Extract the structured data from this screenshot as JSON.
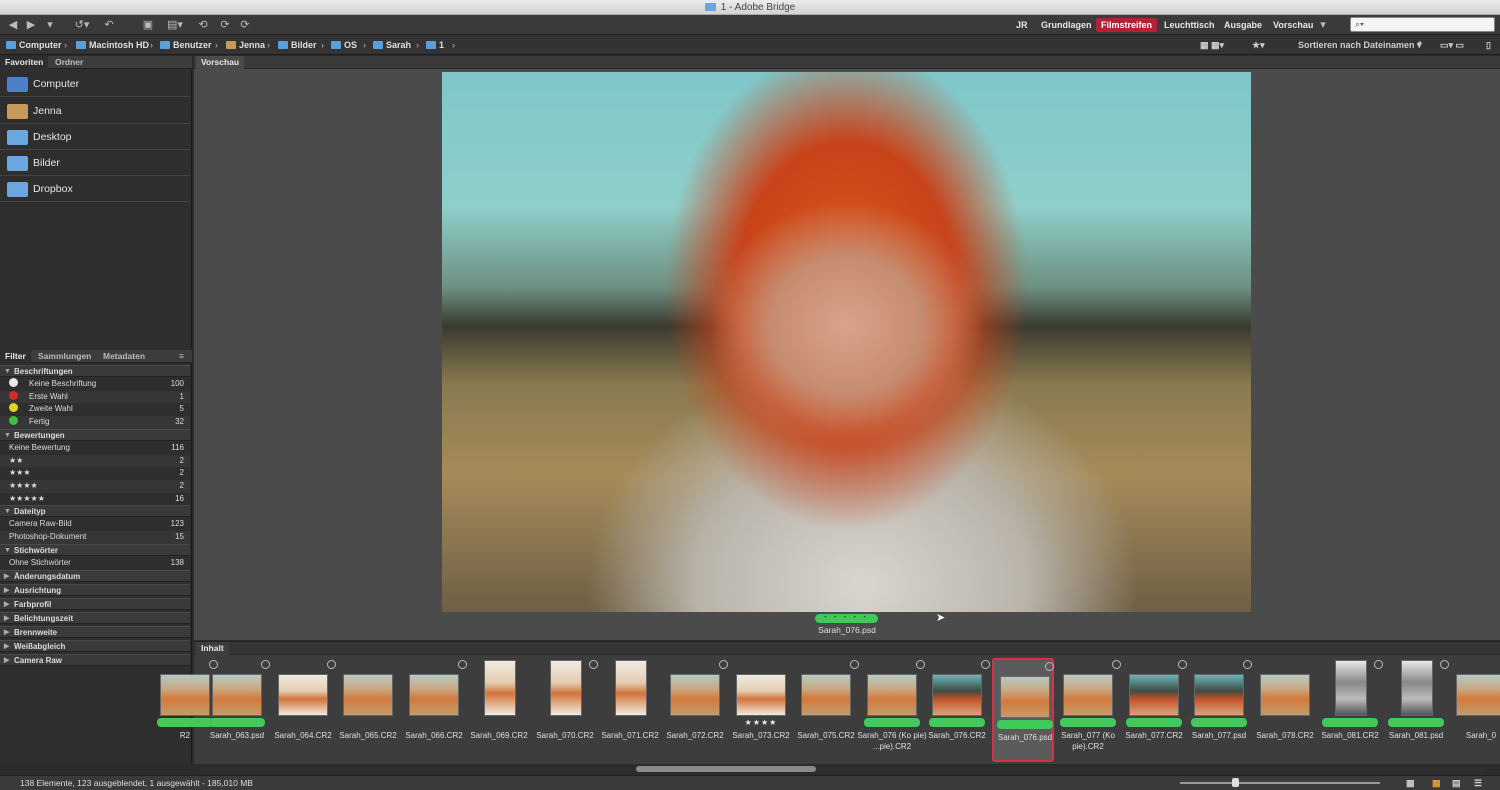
{
  "window": {
    "title": "1 - Adobe Bridge"
  },
  "toolbar": {
    "workspaces": [
      "JR",
      "Grundlagen",
      "Filmstreifen",
      "Leuchttisch",
      "Ausgabe",
      "Vorschau"
    ],
    "active_workspace": "Filmstreifen",
    "search_placeholder": "⌕▾",
    "icons": [
      "back-icon",
      "forward-icon",
      "recent-icon",
      "boomerang-icon",
      "camera-download-icon",
      "output-icon",
      "refine-icon",
      "rotate-left-icon",
      "rotate-right-icon",
      "workspace-menu-icon"
    ]
  },
  "path": {
    "crumbs": [
      "Computer",
      "Macintosh HD",
      "Benutzer",
      "Jenna",
      "Bilder",
      "OS",
      "Sarah",
      "1"
    ],
    "sort_label": "Sortieren nach Dateinamen",
    "icons": [
      "quality-icon",
      "star-filter-icon",
      "sort-asc-icon",
      "new-folder-icon",
      "delete-icon"
    ]
  },
  "left_panel": {
    "top_tabs": [
      "Favoriten",
      "Ordner"
    ],
    "favorites": [
      "Computer",
      "Jenna",
      "Desktop",
      "Bilder",
      "Dropbox"
    ],
    "bottom_tabs": [
      "Filter",
      "Sammlungen",
      "Metadaten"
    ],
    "filter_groups": [
      {
        "title": "Beschriftungen",
        "rows": [
          {
            "label": "Keine Beschriftung",
            "count": "100",
            "color": "#e8e8e8"
          },
          {
            "label": "Erste Wahl",
            "count": "1",
            "color": "#d42a2a"
          },
          {
            "label": "Zweite Wahl",
            "count": "5",
            "color": "#e6d21e"
          },
          {
            "label": "Fertig",
            "count": "32",
            "color": "#3fbf3f"
          }
        ]
      },
      {
        "title": "Bewertungen",
        "rows": [
          {
            "label": "Keine Bewertung",
            "count": "116"
          },
          {
            "label": "★★",
            "count": "2"
          },
          {
            "label": "★★★",
            "count": "2"
          },
          {
            "label": "★★★★",
            "count": "2"
          },
          {
            "label": "★★★★★",
            "count": "16"
          }
        ]
      },
      {
        "title": "Dateityp",
        "rows": [
          {
            "label": "Camera Raw-Bild",
            "count": "123"
          },
          {
            "label": "Photoshop-Dokument",
            "count": "15"
          }
        ]
      },
      {
        "title": "Stichwörter",
        "rows": [
          {
            "label": "Ohne Stichwörter",
            "count": "138"
          }
        ]
      }
    ],
    "collapsed_groups": [
      "Änderungsdatum",
      "Ausrichtung",
      "Farbprofil",
      "Belichtungszeit",
      "Brennweite",
      "Weißabgleich",
      "Camera Raw"
    ]
  },
  "preview": {
    "tab": "Vorschau",
    "caption": "Sarah_076.psd",
    "rating_dots": "• • • • •"
  },
  "content": {
    "tab": "Inhalt",
    "thumbnails": [
      {
        "caption": "R2",
        "style": "warm",
        "pill": true
      },
      {
        "caption": "Sarah_063.psd",
        "style": "warm",
        "pill": true
      },
      {
        "caption": "Sarah_064.CR2",
        "style": "white",
        "pill": false
      },
      {
        "caption": "Sarah_065.CR2",
        "style": "warm",
        "pill": false
      },
      {
        "caption": "Sarah_066.CR2",
        "style": "warm",
        "pill": false
      },
      {
        "caption": "Sarah_069.CR2",
        "style": "white",
        "pill": false,
        "portrait": true
      },
      {
        "caption": "Sarah_070.CR2",
        "style": "white",
        "pill": false,
        "portrait": true
      },
      {
        "caption": "Sarah_071.CR2",
        "style": "white",
        "pill": false,
        "portrait": true
      },
      {
        "caption": "Sarah_072.CR2",
        "style": "warm",
        "pill": false
      },
      {
        "caption": "Sarah_073.CR2",
        "style": "white",
        "pill": false,
        "stars": "★★★★"
      },
      {
        "caption": "Sarah_075.CR2",
        "style": "warm",
        "pill": false
      },
      {
        "caption": "Sarah_076 (Ko pie) ...pie).CR2",
        "style": "warm",
        "pill": true
      },
      {
        "caption": "Sarah_076.CR2",
        "style": "teal",
        "pill": true
      },
      {
        "caption": "Sarah_076.psd",
        "style": "warm",
        "pill": true,
        "selected": true
      },
      {
        "caption": "Sarah_077 (Ko pie).CR2",
        "style": "warm",
        "pill": true
      },
      {
        "caption": "Sarah_077.CR2",
        "style": "teal",
        "pill": true
      },
      {
        "caption": "Sarah_077.psd",
        "style": "teal",
        "pill": true
      },
      {
        "caption": "Sarah_078.CR2",
        "style": "warm",
        "pill": false
      },
      {
        "caption": "Sarah_081.CR2",
        "style": "bw",
        "pill": true,
        "portrait": true
      },
      {
        "caption": "Sarah_081.psd",
        "style": "bw",
        "pill": true,
        "portrait": true
      },
      {
        "caption": "Sarah_0",
        "style": "warm",
        "pill": false
      }
    ]
  },
  "status": {
    "text": "138 Elemente, 123 ausgeblendet, 1 ausgewählt - 185,010 MB"
  }
}
